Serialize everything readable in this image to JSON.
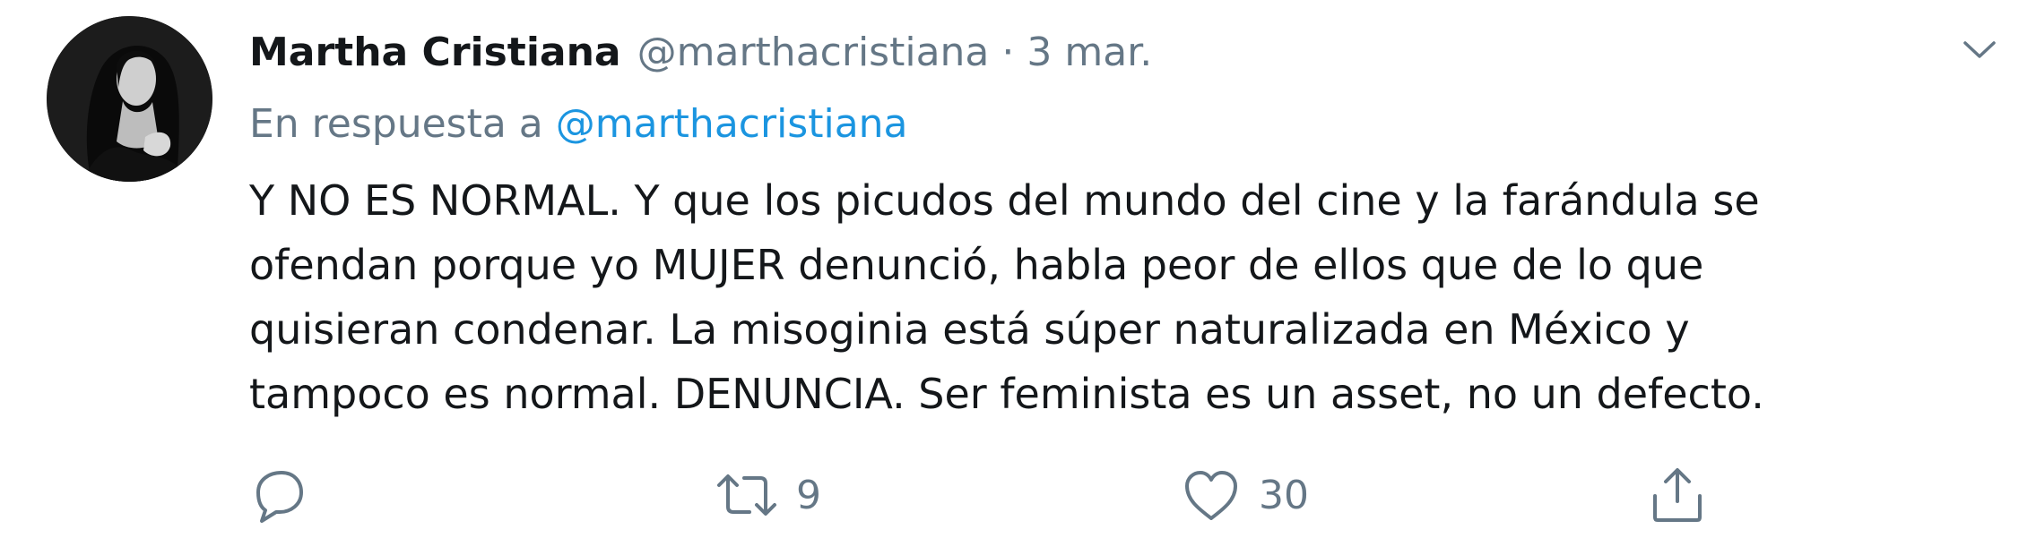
{
  "tweet": {
    "author_name": "Martha Cristiana",
    "author_handle": "@marthacristiana",
    "separator": "·",
    "date": "3 mar.",
    "reply_prefix": "En respuesta a",
    "reply_handle": "@marthacristiana",
    "text": "Y NO ES NORMAL. Y que los picudos del mundo del cine y la farándula se\nofendan porque yo MUJER denunció, habla peor de ellos que de lo que\nquisieran condenar. La misoginia está súper naturalizada en México y\ntampoco es normal. DENUNCIA.  Ser feminista es un asset, no un defecto."
  },
  "actions": {
    "reply": {
      "icon": "reply-icon"
    },
    "retweet": {
      "icon": "retweet-icon",
      "count": "9"
    },
    "like": {
      "icon": "heart-icon",
      "count": "30"
    },
    "share": {
      "icon": "share-icon"
    }
  },
  "colors": {
    "text": "#14171a",
    "secondary": "#657786",
    "link": "#1b95e0"
  }
}
